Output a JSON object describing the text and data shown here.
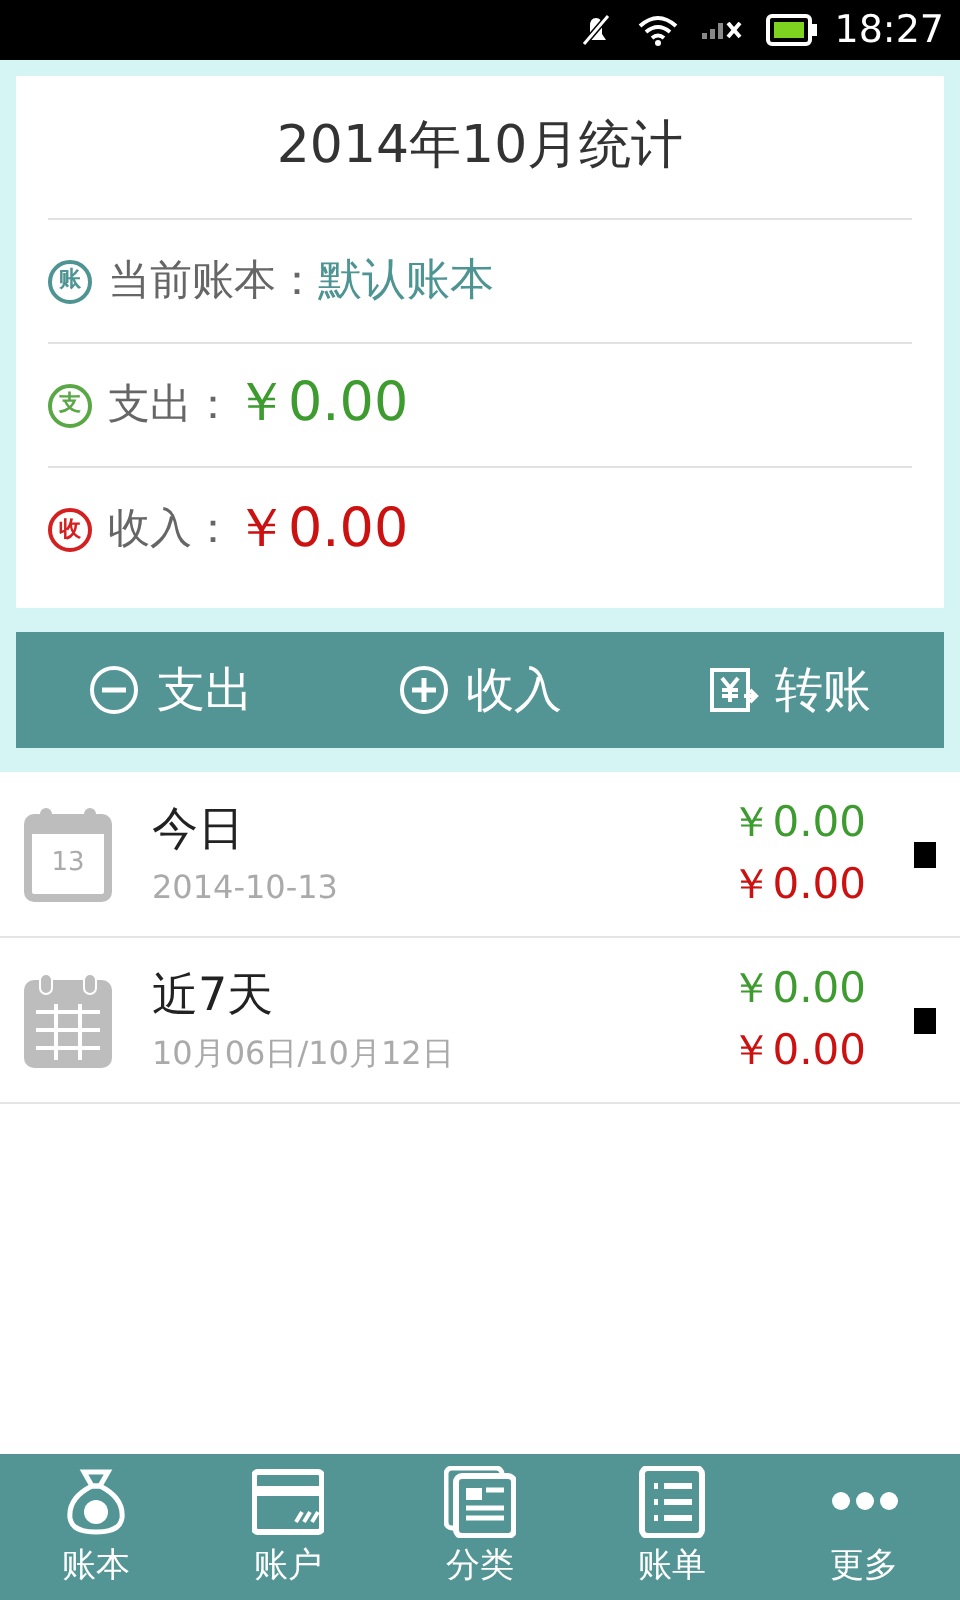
{
  "status_bar": {
    "time": "18:27"
  },
  "summary": {
    "title": "2014年10月统计",
    "rows": [
      {
        "kind": "book",
        "badge": "账",
        "label": "当前账本：",
        "value": "默认账本"
      },
      {
        "kind": "expense",
        "badge": "支",
        "label": "支出：",
        "value": "￥0.00"
      },
      {
        "kind": "income",
        "badge": "收",
        "label": "收入：",
        "value": "￥0.00"
      }
    ]
  },
  "actions": [
    {
      "kind": "minus",
      "label": "支出"
    },
    {
      "kind": "plus",
      "label": "收入"
    },
    {
      "kind": "transfer",
      "label": "转账"
    }
  ],
  "periods": [
    {
      "kind": "day",
      "icon_text": "13",
      "title": "今日",
      "subtitle": "2014-10-13",
      "expense": "￥0.00",
      "income": "￥0.00"
    },
    {
      "kind": "week",
      "title": "近7天",
      "subtitle": "10月06日/10月12日",
      "expense": "￥0.00",
      "income": "￥0.00"
    }
  ],
  "nav": [
    {
      "kind": "bag",
      "label": "账本"
    },
    {
      "kind": "card",
      "label": "账户"
    },
    {
      "kind": "pages",
      "label": "分类"
    },
    {
      "kind": "list",
      "label": "账单"
    },
    {
      "kind": "dots",
      "label": "更多"
    }
  ]
}
